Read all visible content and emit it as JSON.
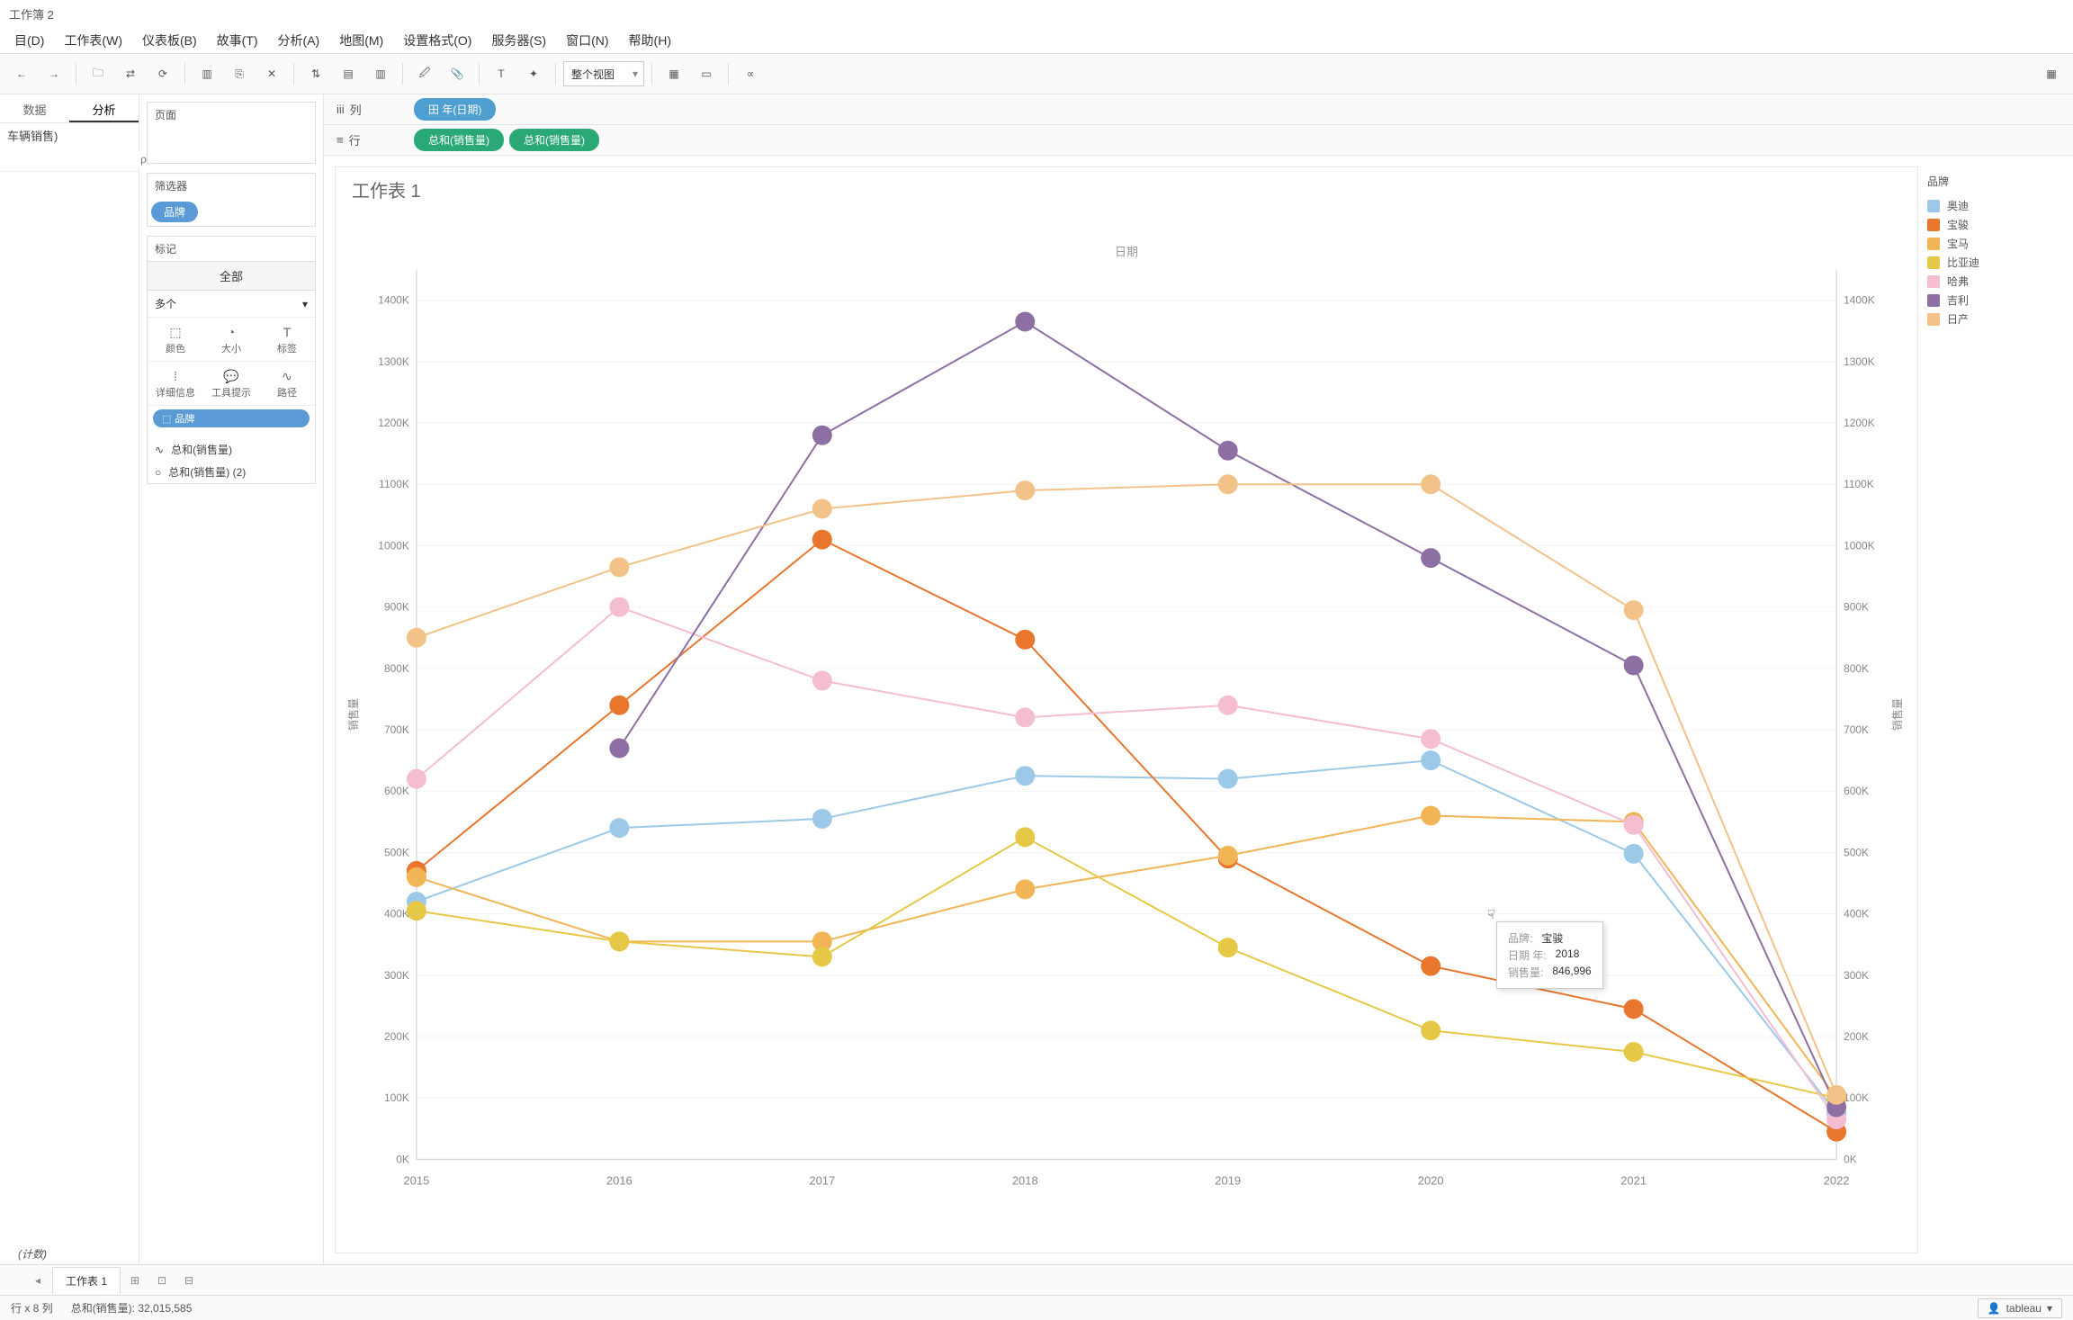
{
  "window_title": "工作簿 2",
  "menus": [
    "目(D)",
    "工作表(W)",
    "仪表板(B)",
    "故事(T)",
    "分析(A)",
    "地图(M)",
    "设置格式(O)",
    "服务器(S)",
    "窗口(N)",
    "帮助(H)"
  ],
  "toolbar": {
    "view_mode": "整个视图"
  },
  "side_tabs": {
    "data": "数据",
    "analysis": "分析"
  },
  "data_source": "车辆销售)",
  "dim_count": "(计数)",
  "pages_label": "页面",
  "filters_label": "筛选器",
  "filter_pill": "品牌",
  "marks": {
    "label": "标记",
    "all": "全部",
    "type": "多个",
    "color": "颜色",
    "size": "大小",
    "label_m": "标签",
    "detail": "详细信息",
    "tooltip": "工具提示",
    "path": "路径",
    "pill": "品牌",
    "agg1": "总和(销售量)",
    "agg2": "总和(销售量) (2)"
  },
  "shelves": {
    "columns_label": "列",
    "rows_label": "行",
    "col_pill": "田 年(日期)",
    "row_pill1": "总和(销售量)",
    "row_pill2": "总和(销售量)"
  },
  "sheet_title": "工作表 1",
  "axis_title_top": "日期",
  "axis_label_left": "销售量",
  "axis_label_right": "销售量",
  "legend_title": "品牌",
  "legend": [
    {
      "name": "奥迪",
      "color": "#9cc9e8"
    },
    {
      "name": "宝骏",
      "color": "#e8762d"
    },
    {
      "name": "宝马",
      "color": "#f2b556"
    },
    {
      "name": "比亚迪",
      "color": "#e6c847"
    },
    {
      "name": "哈弗",
      "color": "#f4bdd1"
    },
    {
      "name": "吉利",
      "color": "#8e6fa3"
    },
    {
      "name": "日产",
      "color": "#f2c288"
    }
  ],
  "tooltip": {
    "k1": "品牌:",
    "v1": "宝骏",
    "k2": "日期 年:",
    "v2": "2018",
    "k3": "销售量:",
    "v3": "846,996"
  },
  "sheet_tab": "工作表 1",
  "status": {
    "rows": "行 x 8 列",
    "sum": "总和(销售量): 32,015,585",
    "user": "tableau"
  },
  "chart_data": {
    "type": "line",
    "xlabel": "日期",
    "ylabel": "销售量",
    "x": [
      2015,
      2016,
      2017,
      2018,
      2019,
      2020,
      2021,
      2022
    ],
    "ylim": [
      0,
      1450000
    ],
    "y_ticks": [
      "0K",
      "100K",
      "200K",
      "300K",
      "400K",
      "500K",
      "600K",
      "700K",
      "800K",
      "900K",
      "1000K",
      "1100K",
      "1200K",
      "1300K",
      "1400K"
    ],
    "series": [
      {
        "name": "奥迪",
        "color": "#9cc9e8",
        "values": [
          420000,
          540000,
          555000,
          625000,
          620000,
          650000,
          498000,
          75000
        ]
      },
      {
        "name": "宝骏",
        "color": "#e8762d",
        "values": [
          470000,
          740000,
          1010000,
          846996,
          490000,
          315000,
          245000,
          45000
        ]
      },
      {
        "name": "宝马",
        "color": "#f2b556",
        "values": [
          460000,
          355000,
          355000,
          440000,
          495000,
          560000,
          550000,
          100000
        ]
      },
      {
        "name": "比亚迪",
        "color": "#e6c847",
        "values": [
          405000,
          355000,
          330000,
          525000,
          345000,
          210000,
          175000,
          100000
        ]
      },
      {
        "name": "哈弗",
        "color": "#f4bdd1",
        "values": [
          620000,
          900000,
          780000,
          720000,
          740000,
          685000,
          545000,
          65000
        ]
      },
      {
        "name": "吉利",
        "color": "#8e6fa3",
        "values": [
          null,
          670000,
          1180000,
          1365000,
          1155000,
          980000,
          805000,
          85000
        ]
      },
      {
        "name": "日产",
        "color": "#f2c288",
        "values": [
          850000,
          965000,
          1060000,
          1090000,
          1100000,
          1100000,
          895000,
          105000
        ]
      }
    ]
  }
}
